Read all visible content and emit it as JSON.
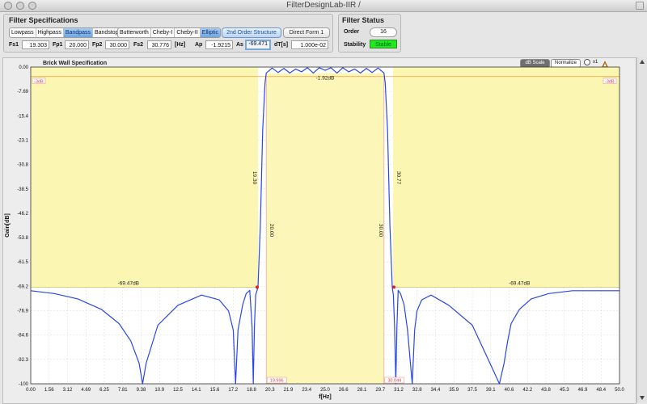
{
  "window": {
    "title": "FilterDesignLab-IIR /"
  },
  "spec": {
    "title": "Filter Specifications",
    "types": [
      "Lowpass",
      "Highpass",
      "Bandpass",
      "Bandstop"
    ],
    "selected_type": "Bandpass",
    "approximations": [
      "Butterworth",
      "Cheby-I",
      "Cheby-II",
      "Elliptic"
    ],
    "selected_approx": "Elliptic",
    "structure_2nd": "2nd Order Structure",
    "direct_form": "Direct Form 1",
    "fs1_label": "Fs1",
    "fs1": "19.303",
    "fp1_label": "Fp1",
    "fp1": "20.000",
    "fp2_label": "Fp2",
    "fp2": "30.000",
    "fs2_label": "Fs2",
    "fs2": "30.776",
    "hz_label": "[Hz]",
    "ap_label": "Ap",
    "ap": "-1.9215",
    "as_label": "As",
    "as": "-69.471",
    "dt_label": "dT[s]",
    "dt": "1.000e-02"
  },
  "status": {
    "title": "Filter Status",
    "order_label": "Order",
    "order": "16",
    "stability_label": "Stability",
    "stability": "Stable"
  },
  "plot": {
    "panel_title": "Brick Wall Specification",
    "db_scale": "dB Scale",
    "normalize": "Normalize",
    "zoom": "x1"
  },
  "colors": {
    "stopband_fill": "#fbf5aa",
    "passband_fill": "#fcf6b2",
    "response": "#2a47e6",
    "marker": "#e02020",
    "minus3db": "#f2a040"
  },
  "chart_data": {
    "type": "line",
    "xlabel": "f[Hz]",
    "ylabel": "Gain[dB]",
    "xlim": [
      0,
      50
    ],
    "ylim": [
      -100,
      0
    ],
    "x_ticks": [
      "0.00",
      "1.56",
      "3.12",
      "4.69",
      "6.25",
      "7.81",
      "9.38",
      "10.9",
      "12.5",
      "14.1",
      "15.6",
      "17.2",
      "18.8",
      "20.3",
      "21.9",
      "23.4",
      "25.0",
      "26.6",
      "28.1",
      "29.7",
      "31.2",
      "32.8",
      "34.4",
      "35.9",
      "37.5",
      "39.1",
      "40.6",
      "42.2",
      "43.8",
      "45.3",
      "46.9",
      "48.4",
      "50.0"
    ],
    "y_ticks": [
      "0.00",
      "-7.69",
      "-15.4",
      "-23.1",
      "-30.8",
      "-38.5",
      "-46.2",
      "-53.8",
      "-61.5",
      "-69.2",
      "-76.9",
      "-84.6",
      "-92.3",
      "-100"
    ],
    "fs1": 19.3,
    "fp1": 20.0,
    "fp2": 30.0,
    "fs2": 30.77,
    "ripple_db": -1.92,
    "stop_atten_db": -69.47,
    "minus3_label": "-3dB",
    "ap_label": "-1.92dB",
    "as_label_left": "-69.47dB",
    "as_label_right": "-69.47dB",
    "fs1_label": "19.30",
    "fp1_label": "20.00",
    "fp2_label": "30.00",
    "fs2_label": "30.77",
    "fp1_box": "19.996",
    "fp2_box": "30.044",
    "stopband_zeros": [
      9.5,
      17.4,
      18.9,
      31.1,
      32.6,
      40.5
    ],
    "series": [
      {
        "x": [
          0,
          2,
          4,
          6,
          7.5,
          8.5,
          9.2,
          9.5,
          9.8,
          10.8,
          12.5,
          14.5,
          16,
          16.8,
          17.2,
          17.4,
          17.6,
          18,
          18.3,
          18.6,
          18.8,
          18.9,
          19.0,
          19.1,
          19.3,
          19.5,
          19.7,
          19.9,
          20.0,
          20.5,
          21,
          21.5,
          22,
          22.5,
          23,
          23.5,
          24,
          24.5,
          25,
          25.5,
          26,
          26.5,
          27,
          27.5,
          28,
          28.5,
          29,
          29.5,
          30,
          30.1,
          30.3,
          30.5,
          30.7,
          30.8,
          30.9,
          31.0,
          31.1,
          31.2,
          31.4,
          31.7,
          32,
          32.4,
          32.6,
          32.8,
          33.2,
          34,
          35.5,
          37.5,
          39,
          39.8,
          40.2,
          40.5,
          40.8,
          41.5,
          42.5,
          44,
          46,
          48,
          50
        ],
        "y": [
          -70.6,
          -71.5,
          -73.2,
          -76.5,
          -81,
          -86.5,
          -93.5,
          -100,
          -93.5,
          -81.5,
          -75.2,
          -72,
          -73.5,
          -77,
          -83,
          -100,
          -83,
          -75,
          -71.5,
          -70.5,
          -82,
          -100,
          -82,
          -72,
          -69.5,
          -50,
          -20,
          -5,
          -1.9,
          -0.3,
          -1.7,
          -0.4,
          -1.9,
          -0.6,
          -1.5,
          -0.2,
          -1.9,
          -0.2,
          -1.0,
          -0.2,
          -1.9,
          -0.2,
          -1.5,
          -0.6,
          -1.9,
          -0.4,
          -1.7,
          -0.3,
          -1.9,
          -5,
          -20,
          -50,
          -69.5,
          -72,
          -82,
          -100,
          -82,
          -70.5,
          -71.5,
          -75,
          -83,
          -100,
          -83,
          -77,
          -73.5,
          -72,
          -75.2,
          -81.5,
          -93.5,
          -100,
          -93.5,
          -86.5,
          -81,
          -76.5,
          -73.2,
          -71.5,
          -70.6,
          -70.6,
          -70.6
        ]
      }
    ]
  }
}
